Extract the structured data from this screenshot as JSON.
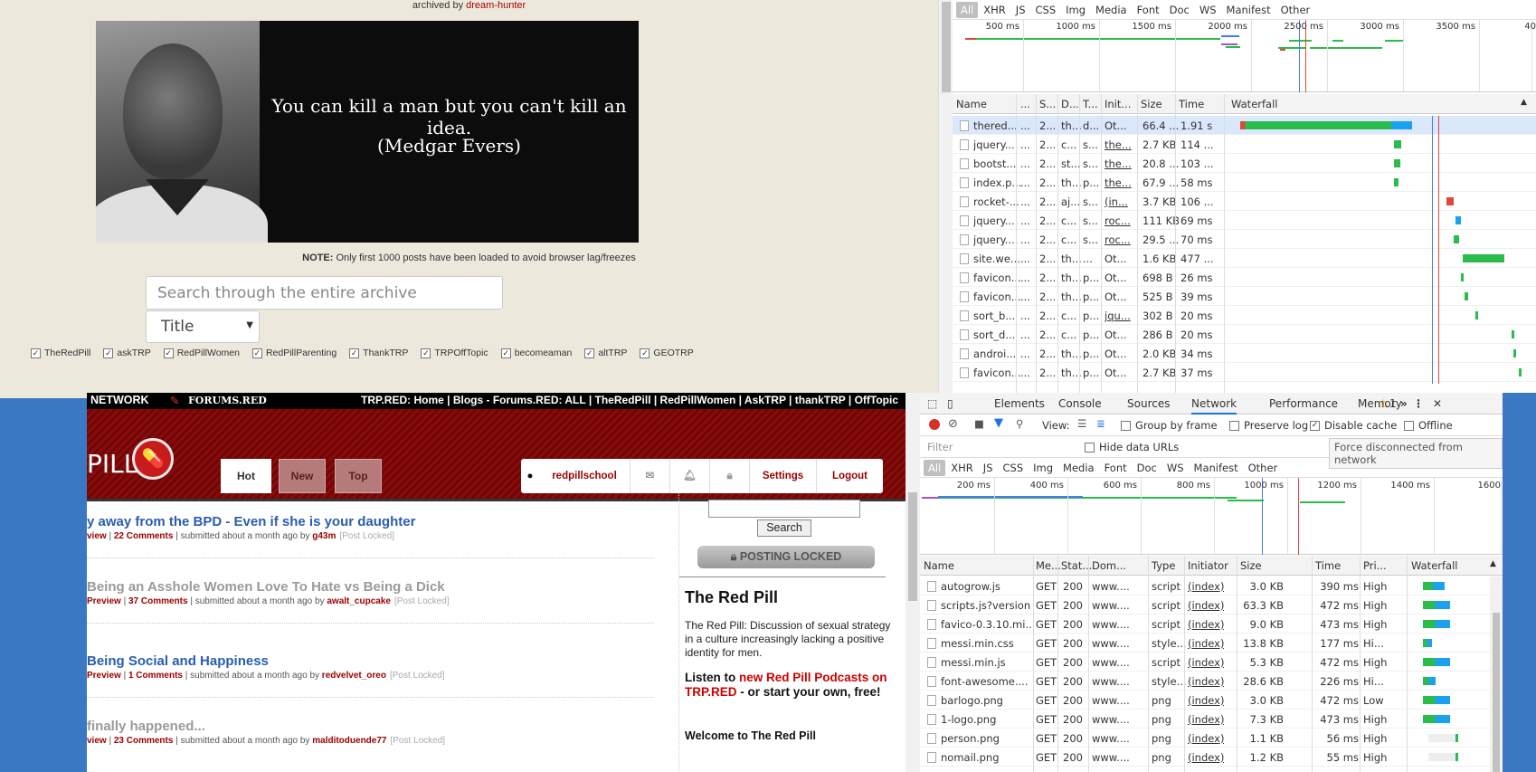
{
  "archive": {
    "archived_by_prefix": "archived by",
    "archived_by_user": "dream-hunter",
    "quote_line1": "You can kill a man but you can't kill an idea.",
    "quote_line2": "(Medgar Evers)",
    "note_label": "NOTE:",
    "note_text": "Only first 1000 posts have been loaded to avoid browser lag/freezes",
    "search_placeholder": "Search through the entire archive",
    "select_value": "Title",
    "subreddits": [
      "TheRedPill",
      "askTRP",
      "RedPillWomen",
      "RedPillParenting",
      "ThankTRP",
      "TRPOffTopic",
      "becomeaman",
      "altTRP",
      "GEOTRP"
    ]
  },
  "devtools_top": {
    "filter_types": [
      "All",
      "XHR",
      "JS",
      "CSS",
      "Img",
      "Media",
      "Font",
      "Doc",
      "WS",
      "Manifest",
      "Other"
    ],
    "timeline_ticks": [
      "500 ms",
      "1000 ms",
      "1500 ms",
      "2000 ms",
      "2500 ms",
      "3000 ms",
      "3500 ms",
      "40"
    ],
    "columns": [
      "Name",
      "...",
      "S...",
      "D...",
      "T...",
      "Init...",
      "Size",
      "Time",
      "Waterfall"
    ],
    "rows": [
      {
        "name": "thered...",
        "m": "...",
        "s": "2...",
        "d": "th...",
        "t": "d...",
        "i": "Ot...",
        "size": "66.4 ...",
        "time": "1.91 s",
        "w": "..."
      },
      {
        "name": "jquery....",
        "m": "...",
        "s": "2...",
        "d": "c...",
        "t": "s...",
        "i": "the...",
        "size": "2.7 KB",
        "time": "114 ...",
        "w": "..."
      },
      {
        "name": "bootst...",
        "m": "...",
        "s": "2...",
        "d": "st...",
        "t": "s...",
        "i": "the...",
        "size": "20.8 ...",
        "time": "103 ...",
        "w": "..."
      },
      {
        "name": "index.p...",
        "m": "...",
        "s": "2...",
        "d": "th...",
        "t": "p...",
        "i": "the...",
        "size": "67.9 ...",
        "time": "58 ms",
        "w": "..."
      },
      {
        "name": "rocket-...",
        "m": "...",
        "s": "2...",
        "d": "aj...",
        "t": "s...",
        "i": "(in...",
        "size": "3.7 KB",
        "time": "106 ...",
        "w": "..."
      },
      {
        "name": "jquery....",
        "m": "...",
        "s": "2...",
        "d": "c...",
        "t": "s...",
        "i": "roc...",
        "size": "111 KB",
        "time": "69 ms",
        "w": "..."
      },
      {
        "name": "jquery....",
        "m": "...",
        "s": "2...",
        "d": "c...",
        "t": "s...",
        "i": "roc...",
        "size": "29.5 ...",
        "time": "70 ms",
        "w": "..."
      },
      {
        "name": "site.we...",
        "m": "...",
        "s": "2...",
        "d": "th...",
        "t": "...",
        "i": "Ot...",
        "size": "1.6 KB",
        "time": "477 ...",
        "w": "..."
      },
      {
        "name": "favicon...",
        "m": "...",
        "s": "2...",
        "d": "th...",
        "t": "p...",
        "i": "Ot...",
        "size": "698 B",
        "time": "26 ms",
        "w": "..."
      },
      {
        "name": "favicon...",
        "m": "...",
        "s": "2...",
        "d": "th...",
        "t": "p...",
        "i": "Ot...",
        "size": "525 B",
        "time": "39 ms",
        "w": "..."
      },
      {
        "name": "sort_b...",
        "m": "...",
        "s": "2...",
        "d": "c...",
        "t": "p...",
        "i": "jqu...",
        "size": "302 B",
        "time": "20 ms",
        "w": "..."
      },
      {
        "name": "sort_d...",
        "m": "...",
        "s": "2...",
        "d": "c...",
        "t": "p...",
        "i": "Ot...",
        "size": "286 B",
        "time": "20 ms",
        "w": "..."
      },
      {
        "name": "androi...",
        "m": "...",
        "s": "2...",
        "d": "th...",
        "t": "p...",
        "i": "Ot...",
        "size": "2.0 KB",
        "time": "34 ms",
        "w": "..."
      },
      {
        "name": "favicon...",
        "m": "...",
        "s": "2...",
        "d": "th...",
        "t": "p...",
        "i": "Ot...",
        "size": "2.7 KB",
        "time": "37 ms",
        "w": "..."
      }
    ]
  },
  "site": {
    "network_label": "NETWORK",
    "forums_label": "FORUMS.RED",
    "topnav": "TRP.RED: Home | Blogs - Forums.RED: ALL | TheRedPill | RedPillWomen | AskTRP | thankTRP | OffTopic",
    "logo_text": "PILL",
    "nav": [
      "Hot",
      "New",
      "Top"
    ],
    "username": "redpillschool",
    "settings": "Settings",
    "logout": "Logout",
    "posts": [
      {
        "title": "y away from the BPD - Even if she is your daughter",
        "meta_a": "view",
        "sep1": " | ",
        "meta_b": "22 Comments",
        "meta_c": " | submitted about a month ago by ",
        "user": "g43m",
        "locked": "[Post Locked]",
        "color": "#2a5db0"
      },
      {
        "title": "Being an Asshole Women Love To Hate vs Being a Dick",
        "meta_a": "Preview",
        "sep1": " | ",
        "meta_b": "37 Comments",
        "meta_c": " | submitted about a month ago by ",
        "user": "awalt_cupcake",
        "locked": "[Post Locked]",
        "color": "#9a9a9a"
      },
      {
        "title": "Being Social and Happiness",
        "meta_a": "Preview",
        "sep1": " | ",
        "meta_b": "1 Comments",
        "meta_c": " | submitted about a month ago by ",
        "user": "redvelvet_oreo",
        "locked": "[Post Locked]",
        "color": "#2a5db0"
      },
      {
        "title": "finally happened...",
        "meta_a": "view",
        "sep1": " | ",
        "meta_b": "23 Comments",
        "meta_c": " | submitted about a month ago by ",
        "user": "malditoduende77",
        "locked": "[Post Locked]",
        "color": "#9a9a9a"
      }
    ],
    "search_button": "Search",
    "posting_locked": "POSTING LOCKED",
    "sidebar_title": "The Red Pill",
    "sidebar_desc": "The Red Pill: Discussion of sexual strategy in a culture increasingly lacking a positive identity for men.",
    "listen_prefix": "Listen to ",
    "listen_link": "new Red Pill Podcasts on TRP.RED",
    "listen_suffix": " - or start your own, free!",
    "welcome": "Welcome to The Red Pill"
  },
  "devtools_bottom": {
    "tabs": [
      "Elements",
      "Console",
      "Sources",
      "Network",
      "Performance",
      "Memory"
    ],
    "more_tabs": "»",
    "warning_count": "1",
    "view_label": "View:",
    "group_by_frame": "Group by frame",
    "preserve_log": "Preserve log",
    "disable_cache": "Disable cache",
    "offline": "Offline",
    "filter_placeholder": "Filter",
    "hide_data_urls": "Hide data URLs",
    "tooltip": "Force disconnected from network",
    "filter_types": [
      "All",
      "XHR",
      "JS",
      "CSS",
      "Img",
      "Media",
      "Font",
      "Doc",
      "WS",
      "Manifest",
      "Other"
    ],
    "timeline_ticks": [
      "200 ms",
      "400 ms",
      "600 ms",
      "800 ms",
      "1000 ms",
      "1200 ms",
      "1400 ms",
      "1600"
    ],
    "columns": [
      "Name",
      "Me...",
      "Stat...",
      "Dom...",
      "Type",
      "Initiator",
      "Size",
      "Time",
      "Pri...",
      "Waterfall"
    ],
    "rows": [
      {
        "name": "autogrow.js",
        "m": "GET",
        "s": "200",
        "d": "www....",
        "t": "script",
        "i": "(index)",
        "size": "3.0 KB",
        "time": "390 ms",
        "p": "High"
      },
      {
        "name": "scripts.js?version...",
        "m": "GET",
        "s": "200",
        "d": "www....",
        "t": "script",
        "i": "(index)",
        "size": "63.3 KB",
        "time": "472 ms",
        "p": "High"
      },
      {
        "name": "favico-0.3.10.mi...",
        "m": "GET",
        "s": "200",
        "d": "www....",
        "t": "script",
        "i": "(index)",
        "size": "9.0 KB",
        "time": "473 ms",
        "p": "High"
      },
      {
        "name": "messi.min.css",
        "m": "GET",
        "s": "200",
        "d": "www....",
        "t": "style...",
        "i": "(index)",
        "size": "13.8 KB",
        "time": "177 ms",
        "p": "Hi..."
      },
      {
        "name": "messi.min.js",
        "m": "GET",
        "s": "200",
        "d": "www....",
        "t": "script",
        "i": "(index)",
        "size": "5.3 KB",
        "time": "472 ms",
        "p": "High"
      },
      {
        "name": "font-awesome....",
        "m": "GET",
        "s": "200",
        "d": "www....",
        "t": "style...",
        "i": "(index)",
        "size": "28.6 KB",
        "time": "226 ms",
        "p": "Hi..."
      },
      {
        "name": "barlogo.png",
        "m": "GET",
        "s": "200",
        "d": "www....",
        "t": "png",
        "i": "(index)",
        "size": "3.0 KB",
        "time": "472 ms",
        "p": "Low"
      },
      {
        "name": "1-logo.png",
        "m": "GET",
        "s": "200",
        "d": "www....",
        "t": "png",
        "i": "(index)",
        "size": "7.3 KB",
        "time": "473 ms",
        "p": "High"
      },
      {
        "name": "person.png",
        "m": "GET",
        "s": "200",
        "d": "www....",
        "t": "png",
        "i": "(index)",
        "size": "1.1 KB",
        "time": "56 ms",
        "p": "High"
      },
      {
        "name": "nomail.png",
        "m": "GET",
        "s": "200",
        "d": "www....",
        "t": "png",
        "i": "(index)",
        "size": "1.2 KB",
        "time": "55 ms",
        "p": "High"
      }
    ]
  }
}
